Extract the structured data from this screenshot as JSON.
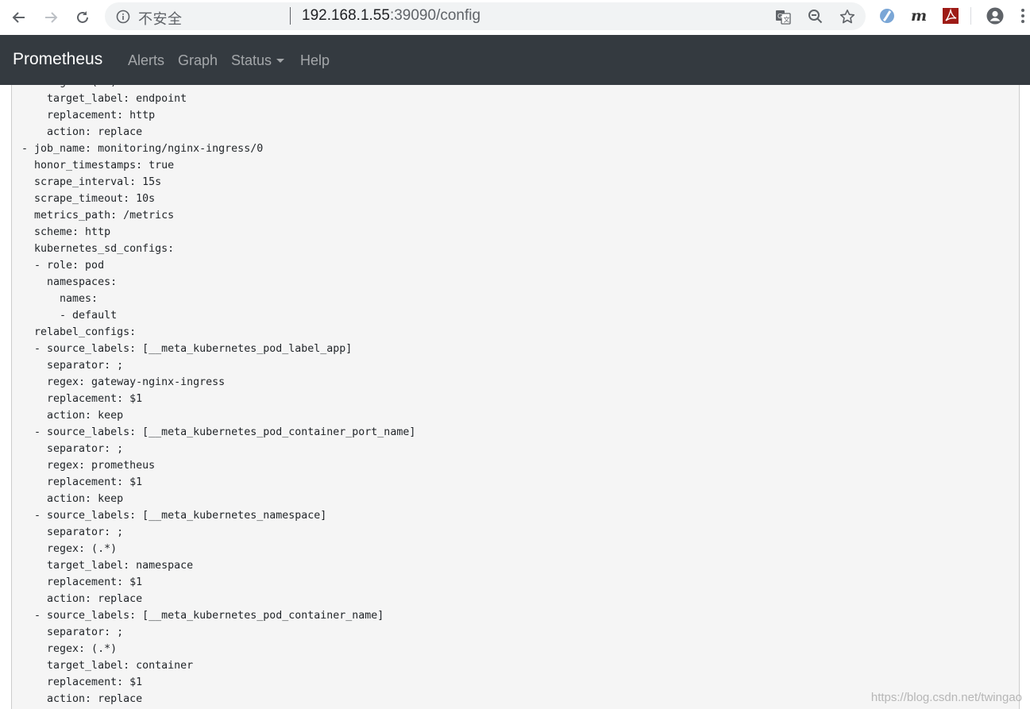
{
  "browser": {
    "security_label": "不安全",
    "url_host": "192.168.1.55",
    "url_rest": ":39090/config"
  },
  "navbar": {
    "brand": "Prometheus",
    "links": [
      "Alerts",
      "Graph",
      "Status",
      "Help"
    ]
  },
  "config": {
    "lines": [
      "    regex: (.*)",
      "    target_label: endpoint",
      "    replacement: http",
      "    action: replace",
      "- job_name: monitoring/nginx-ingress/0",
      "  honor_timestamps: true",
      "  scrape_interval: 15s",
      "  scrape_timeout: 10s",
      "  metrics_path: /metrics",
      "  scheme: http",
      "  kubernetes_sd_configs:",
      "  - role: pod",
      "    namespaces:",
      "      names:",
      "      - default",
      "  relabel_configs:",
      "  - source_labels: [__meta_kubernetes_pod_label_app]",
      "    separator: ;",
      "    regex: gateway-nginx-ingress",
      "    replacement: $1",
      "    action: keep",
      "  - source_labels: [__meta_kubernetes_pod_container_port_name]",
      "    separator: ;",
      "    regex: prometheus",
      "    replacement: $1",
      "    action: keep",
      "  - source_labels: [__meta_kubernetes_namespace]",
      "    separator: ;",
      "    regex: (.*)",
      "    target_label: namespace",
      "    replacement: $1",
      "    action: replace",
      "  - source_labels: [__meta_kubernetes_pod_container_name]",
      "    separator: ;",
      "    regex: (.*)",
      "    target_label: container",
      "    replacement: $1",
      "    action: replace"
    ]
  },
  "watermark": "https://blog.csdn.net/twingao"
}
